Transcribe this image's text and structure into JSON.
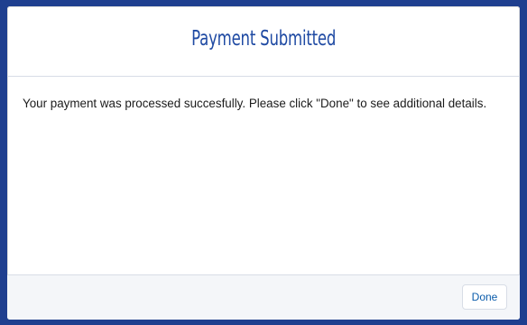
{
  "modal": {
    "title": "Payment Submitted",
    "message": "Your payment was processed succesfully. Please click \"Done\" to see additional details.",
    "done_label": "Done"
  },
  "colors": {
    "frame": "#1f3f8f",
    "title": "#1f4aa3",
    "button_text": "#0b5cab",
    "footer_bg": "#f4f6f9"
  }
}
